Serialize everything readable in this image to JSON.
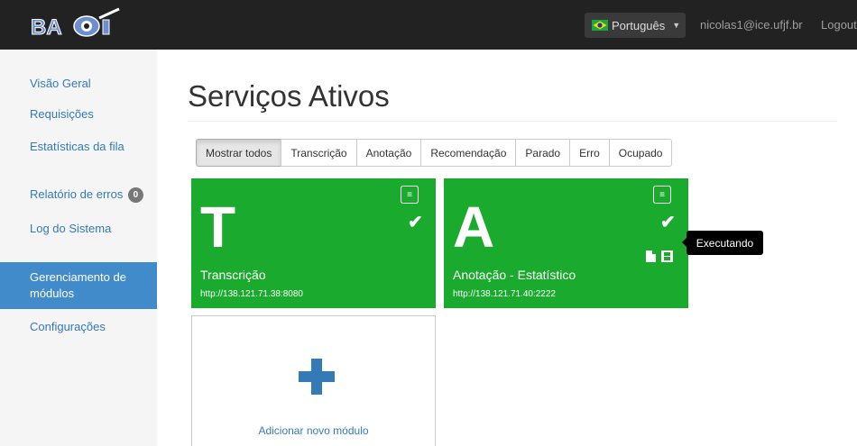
{
  "navbar": {
    "language_label": "Português",
    "user_email": "nicolas1@ice.ufjf.br",
    "logout_label": "Logout"
  },
  "sidebar": {
    "items": [
      {
        "label": "Visão Geral"
      },
      {
        "label": "Requisições"
      },
      {
        "label": "Estatísticas da fila"
      },
      {
        "label": "Relatório de erros",
        "badge": "0"
      },
      {
        "label": "Log do Sistema"
      },
      {
        "label": "Gerenciamento de módulos",
        "active": true
      },
      {
        "label": "Configurações"
      }
    ]
  },
  "main": {
    "title": "Serviços Ativos",
    "filters": [
      {
        "label": "Mostrar todos",
        "active": true
      },
      {
        "label": "Transcrição"
      },
      {
        "label": "Anotação"
      },
      {
        "label": "Recomendação"
      },
      {
        "label": "Parado"
      },
      {
        "label": "Erro"
      },
      {
        "label": "Ocupado"
      }
    ],
    "modules": [
      {
        "letter": "T",
        "name": "Transcrição",
        "url": "http://138.121.71.38:8080",
        "status": "running"
      },
      {
        "letter": "A",
        "name": "Anotação - Estatístico",
        "url": "http://138.121.71.40:2222",
        "status": "running"
      }
    ],
    "add_module_label": "Adicionar novo módulo",
    "tooltip": "Executando"
  },
  "colors": {
    "module_green": "#1aaa2d",
    "navbar_bg": "#222222",
    "active_sidebar": "#428bca",
    "link_blue": "#337ab7"
  }
}
